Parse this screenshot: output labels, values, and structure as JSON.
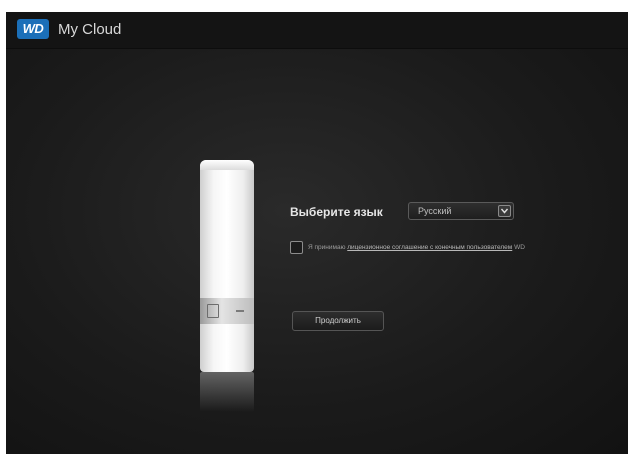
{
  "header": {
    "logo_text": "WD",
    "app_title": "My Cloud"
  },
  "setup": {
    "language_label": "Выберите язык",
    "language_select": {
      "selected": "Русский"
    },
    "agreement": {
      "prefix": "Я принимаю ",
      "link_text": "лицензионное соглашение с конечным пользователем",
      "suffix": " WD",
      "checked": false
    },
    "continue_label": "Продолжить"
  },
  "colors": {
    "brand_blue": "#1b6fb8",
    "background": "#1b1b1b",
    "header": "#141414"
  }
}
